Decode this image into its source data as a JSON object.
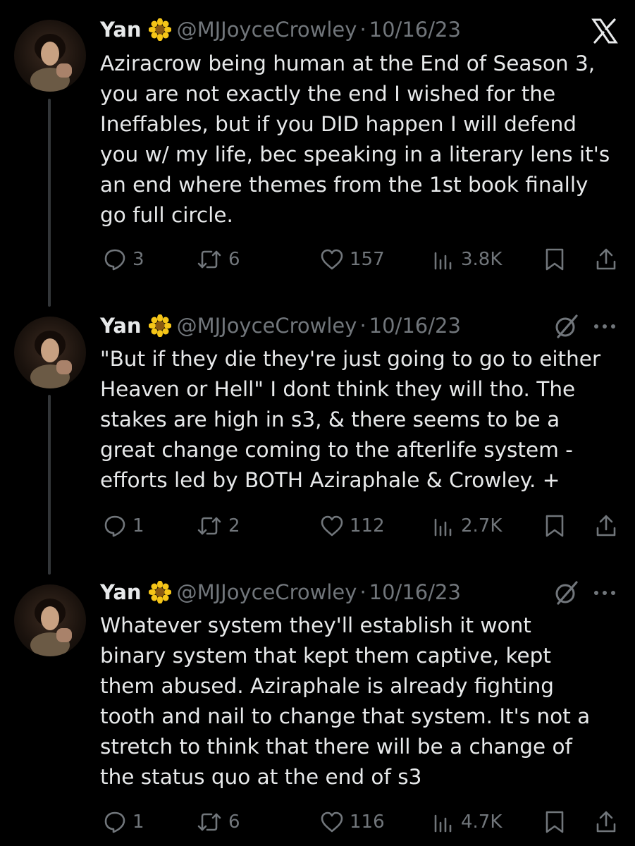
{
  "tweets": [
    {
      "name": "Yan",
      "handle": "@MJJoyceCrowley",
      "separator": "·",
      "date": "10/16/23",
      "corner": "x-logo-icon",
      "body_lines": [
        "Aziracrow being human at the End of Season 3,",
        "you are not exactly the end I wished for the",
        "Ineffables, but if you DID happen I will defend",
        "you w/ my life, bec speaking in a literary lens it's",
        "an end where themes from the 1st book finally",
        "go full circle."
      ],
      "replies": "3",
      "retweets": "6",
      "likes": "157",
      "views": "3.8K"
    },
    {
      "name": "Yan",
      "handle": "@MJJoyceCrowley",
      "separator": "·",
      "date": "10/16/23",
      "corner": "grok-icon",
      "body_lines": [
        "\"But if they die they're just going to go to either",
        "Heaven or Hell\" I dont think they will tho. The",
        "stakes are high in s3, & there seems to be a",
        "great change coming to the afterlife system -",
        "efforts led by BOTH Aziraphale & Crowley. +"
      ],
      "replies": "1",
      "retweets": "2",
      "likes": "112",
      "views": "2.7K"
    },
    {
      "name": "Yan",
      "handle": "@MJJoyceCrowley",
      "separator": "·",
      "date": "10/16/23",
      "corner": "grok-icon",
      "body_lines": [
        "Whatever system they'll establish it wont",
        "binary system that kept them captive, kept",
        "them abused. Aziraphale is already fighting",
        "tooth and nail to change that system. It's not a",
        "stretch to think that there will be a change of",
        "the status quo at the end of s3"
      ],
      "replies": "1",
      "retweets": "6",
      "likes": "116",
      "views": "4.7K"
    }
  ],
  "icons": {
    "name_emoji": "sunflower-icon",
    "reply": "reply-icon",
    "retweet": "retweet-icon",
    "like": "heart-icon",
    "views": "views-icon",
    "bookmark": "bookmark-icon",
    "share": "share-icon",
    "more": "more-icon"
  },
  "colors": {
    "background": "#000000",
    "text": "#e7e9ea",
    "secondary": "#71767b",
    "thread_line": "#333639",
    "flower": "#f5c518"
  }
}
